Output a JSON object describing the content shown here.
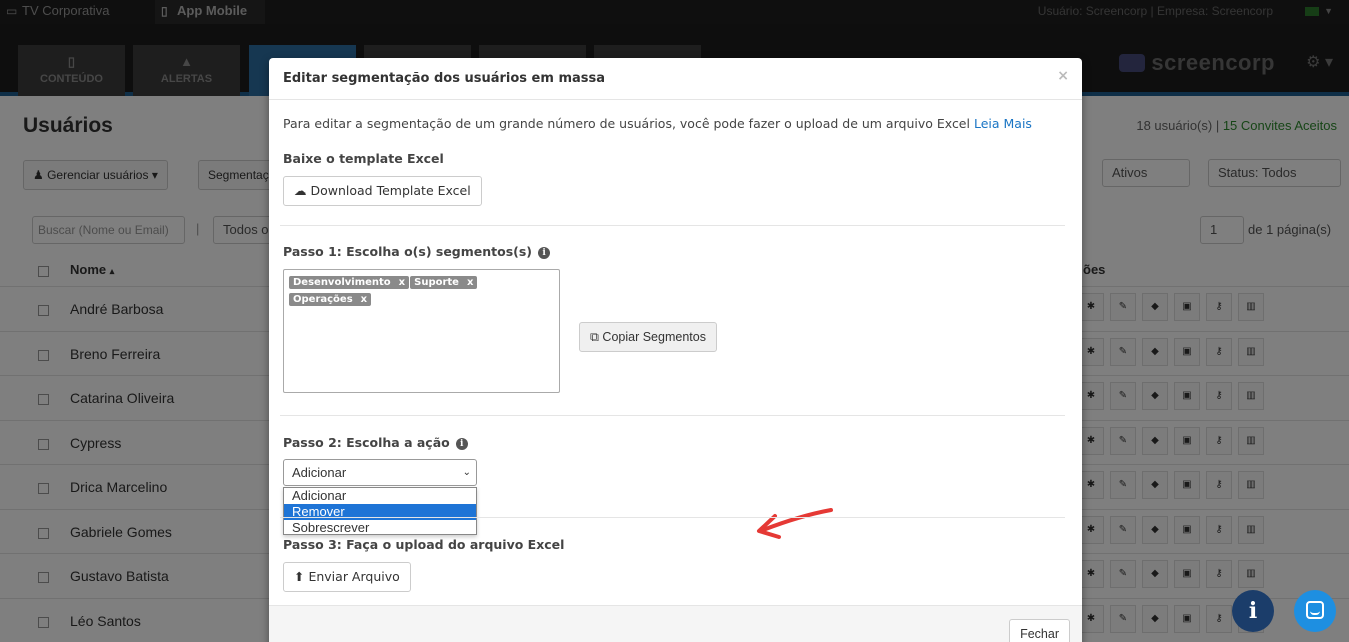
{
  "topbar": {
    "tab_tv": "TV Corporativa",
    "tab_app": "App Mobile",
    "user_info": "Usuário: Screencorp | Empresa: Screencorp"
  },
  "nav": {
    "tabs": [
      {
        "label": "CONTEÚDO",
        "icon": "mobile-icon"
      },
      {
        "label": "ALERTAS",
        "icon": "warning-icon"
      },
      {
        "label": "",
        "icon": "users-icon"
      },
      {
        "label": "",
        "icon": ""
      },
      {
        "label": "",
        "icon": ""
      },
      {
        "label": "",
        "icon": ""
      }
    ],
    "brand": "screencorp"
  },
  "page": {
    "title": "Usuários",
    "count": "18 usuário(s) | ",
    "accepted": "15 Convites Aceitos",
    "manage_button": "Gerenciar usuários",
    "segment_button": "Segmentaç",
    "filter_active": "Ativos",
    "filter_status": "Status: Todos",
    "search_placeholder": "Buscar (Nome ou Email)",
    "separator": "|",
    "all_filter": "Todos o",
    "page_select": "1",
    "pages_text": "de 1 página(s)",
    "col_name": "Nome",
    "col_actions": "ões",
    "rows": [
      "André Barbosa",
      "Breno Ferreira",
      "Catarina Oliveira",
      "Cypress",
      "Drica Marcelino",
      "Gabriele Gomes",
      "Gustavo Batista",
      "Léo Santos"
    ]
  },
  "modal": {
    "title": "Editar segmentação dos usuários em massa",
    "close": "×",
    "intro": "Para editar a segmentação de um grande número de usuários, você pode fazer o upload de um arquivo Excel ",
    "intro_link": "Leia Mais",
    "template_label": "Baixe o template Excel",
    "download_button": "Download Template Excel",
    "step1_label": "Passo 1: Escolha o(s) segmentos(s)",
    "segments": [
      "Desenvolvimento",
      "Suporte",
      "Operações"
    ],
    "copy_button": "Copiar Segmentos",
    "step2_label": "Passo 2: Escolha a ação",
    "action_selected": "Adicionar",
    "action_options": [
      "Adicionar",
      "Remover",
      "Sobrescrever"
    ],
    "highlighted_option": "Remover",
    "step3_label": "Passo 3: Faça o upload do arquivo Excel",
    "upload_button": "Enviar Arquivo",
    "close_button": "Fechar"
  },
  "colors": {
    "highlight": "#1e74d6",
    "link": "#1a75c4",
    "arrow": "#e53935",
    "tag": "#8a8a8a"
  }
}
